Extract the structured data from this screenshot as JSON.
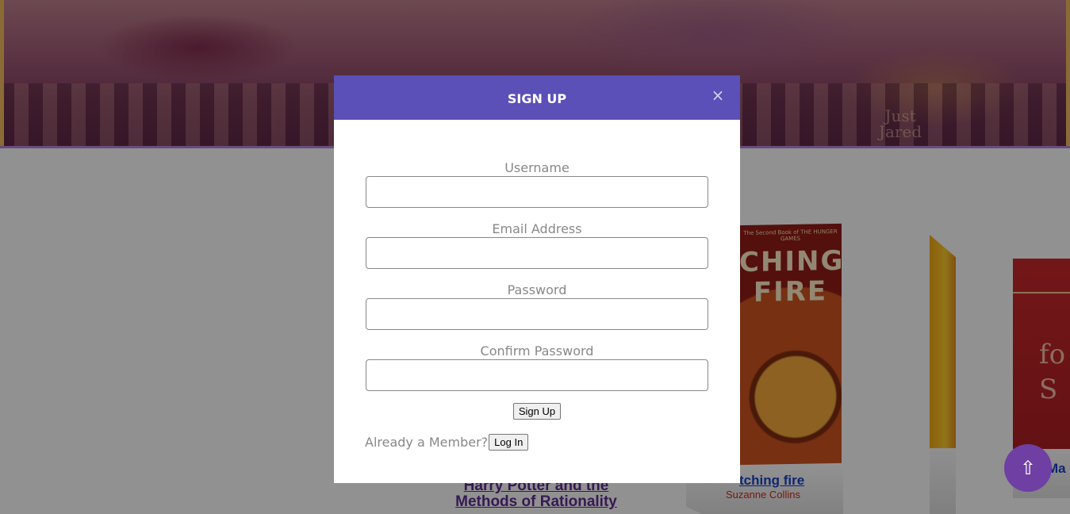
{
  "background": {
    "hero_watermark": [
      "Just",
      "Jared"
    ],
    "books": [
      {
        "title": "Harry Potter and the Methods of Rationality"
      },
      {
        "cover_top_text": "The Second Book of THE HUNGER GAMES",
        "cover_title": "CHING FIRE",
        "link_text": "tching fire",
        "author": "Suzanne Collins"
      },
      {
        "link_text": "Ma"
      },
      {
        "cover_text": "fo S",
        "link_text": "Ma"
      }
    ],
    "scroll_top_icon": "up-arrow-icon",
    "scroll_top_glyph": "⇧"
  },
  "modal": {
    "title": "SIGN UP",
    "close_glyph": "×",
    "fields": [
      {
        "label": "Username",
        "value": "",
        "placeholder": ""
      },
      {
        "label": "Email Address",
        "value": "",
        "placeholder": ""
      },
      {
        "label": "Password",
        "value": "",
        "placeholder": ""
      },
      {
        "label": "Confirm Password",
        "value": "",
        "placeholder": ""
      }
    ],
    "submit_label": "Sign Up",
    "member_text": "Already a Member?",
    "login_label": "Log In"
  },
  "colors": {
    "modal_header": "#5b4fb8",
    "scroll_button": "#6f3fa3",
    "overlay": "rgba(0,0,0,0.4)"
  }
}
